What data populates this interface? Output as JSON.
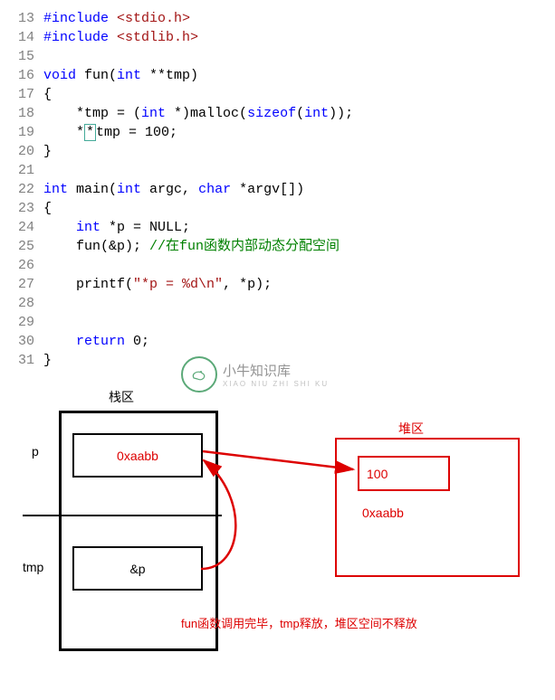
{
  "code": {
    "lines": [
      {
        "n": "13",
        "tokens": [
          {
            "c": "pp",
            "t": "#include"
          },
          {
            "c": "txt",
            "t": " "
          },
          {
            "c": "str",
            "t": "<stdio.h>"
          }
        ]
      },
      {
        "n": "14",
        "tokens": [
          {
            "c": "pp",
            "t": "#include"
          },
          {
            "c": "txt",
            "t": " "
          },
          {
            "c": "str",
            "t": "<stdlib.h>"
          }
        ]
      },
      {
        "n": "15",
        "tokens": []
      },
      {
        "n": "16",
        "tokens": [
          {
            "c": "type",
            "t": "void"
          },
          {
            "c": "txt",
            "t": " fun("
          },
          {
            "c": "type",
            "t": "int"
          },
          {
            "c": "txt",
            "t": " **tmp)"
          }
        ]
      },
      {
        "n": "17",
        "tokens": [
          {
            "c": "txt",
            "t": "{"
          }
        ]
      },
      {
        "n": "18",
        "tokens": [
          {
            "c": "txt",
            "t": "    *tmp = ("
          },
          {
            "c": "type",
            "t": "int"
          },
          {
            "c": "txt",
            "t": " *)malloc("
          },
          {
            "c": "sizeof",
            "t": "sizeof"
          },
          {
            "c": "txt",
            "t": "("
          },
          {
            "c": "type",
            "t": "int"
          },
          {
            "c": "txt",
            "t": "));"
          }
        ]
      },
      {
        "n": "19",
        "tokens": [
          {
            "c": "txt",
            "t": "    *"
          },
          {
            "c": "cursor",
            "t": "*"
          },
          {
            "c": "txt",
            "t": "tmp = 100;"
          }
        ]
      },
      {
        "n": "20",
        "tokens": [
          {
            "c": "txt",
            "t": "}"
          }
        ]
      },
      {
        "n": "21",
        "tokens": []
      },
      {
        "n": "22",
        "tokens": [
          {
            "c": "type",
            "t": "int"
          },
          {
            "c": "txt",
            "t": " main("
          },
          {
            "c": "type",
            "t": "int"
          },
          {
            "c": "txt",
            "t": " argc, "
          },
          {
            "c": "type",
            "t": "char"
          },
          {
            "c": "txt",
            "t": " *argv[])"
          }
        ]
      },
      {
        "n": "23",
        "tokens": [
          {
            "c": "txt",
            "t": "{"
          }
        ]
      },
      {
        "n": "24",
        "tokens": [
          {
            "c": "txt",
            "t": "    "
          },
          {
            "c": "type",
            "t": "int"
          },
          {
            "c": "txt",
            "t": " *p = NULL;"
          }
        ]
      },
      {
        "n": "25",
        "tokens": [
          {
            "c": "txt",
            "t": "    fun(&p); "
          },
          {
            "c": "comment",
            "t": "//在fun函数内部动态分配空间"
          }
        ]
      },
      {
        "n": "26",
        "tokens": []
      },
      {
        "n": "27",
        "tokens": [
          {
            "c": "txt",
            "t": "    printf("
          },
          {
            "c": "str",
            "t": "\"*p = %d\\n\""
          },
          {
            "c": "txt",
            "t": ", *p);"
          }
        ]
      },
      {
        "n": "28",
        "tokens": []
      },
      {
        "n": "29",
        "tokens": []
      },
      {
        "n": "30",
        "tokens": [
          {
            "c": "txt",
            "t": "    "
          },
          {
            "c": "kw",
            "t": "return"
          },
          {
            "c": "txt",
            "t": " 0;"
          }
        ]
      },
      {
        "n": "31",
        "tokens": [
          {
            "c": "txt",
            "t": "}"
          }
        ]
      }
    ]
  },
  "watermark": {
    "title": "小牛知识库",
    "subtitle": "XIAO NIU ZHI SHI KU"
  },
  "diagram": {
    "stack_label": "栈区",
    "heap_label": "堆区",
    "p_label": "p",
    "tmp_label": "tmp",
    "p_value": "0xaabb",
    "tmp_value": "&p",
    "heap_value": "100",
    "heap_addr": "0xaabb",
    "note": "fun函数调用完毕，tmp释放，堆区空间不释放"
  }
}
